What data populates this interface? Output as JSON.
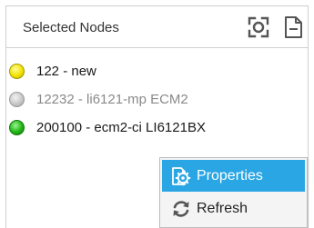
{
  "panel": {
    "title": "Selected Nodes",
    "header_icons": [
      "focus-frame-icon",
      "document-minus-icon"
    ]
  },
  "nodes": [
    {
      "label": "122 - new",
      "status_color": "#f2e300",
      "text_color": "#1a1a1a"
    },
    {
      "label": "12232 - li6121-mp ECM2",
      "status_color": "#c8c8c8",
      "text_color": "#8a8a8a"
    },
    {
      "label": "200100 - ecm2-ci LI6121BX",
      "status_color": "#1fb315",
      "text_color": "#1a1a1a"
    }
  ],
  "context_menu": {
    "items": [
      {
        "label": "Properties",
        "icon": "gear-document-icon",
        "highlighted": true
      },
      {
        "label": "Refresh",
        "icon": "refresh-icon",
        "highlighted": false
      }
    ],
    "highlight_color": "#2aa6e4"
  }
}
